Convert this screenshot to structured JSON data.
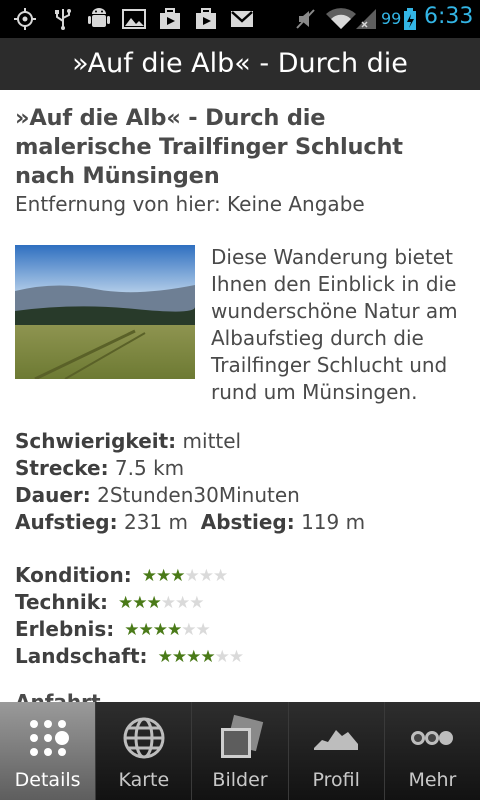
{
  "status_bar": {
    "battery_percent": "99",
    "time": "6:33",
    "icons": [
      "gps-icon",
      "usb-icon",
      "android-debug-icon",
      "picture-icon",
      "play-store-icon",
      "play-store-icon",
      "gmail-icon",
      "mute-icon",
      "wifi-icon",
      "signal-icon",
      "battery-icon"
    ],
    "accent_color": "#33b5e5"
  },
  "action_bar": {
    "title": "»Auf die Alb« - Durch die"
  },
  "article": {
    "title": "»Auf die Alb« - Durch die malerische Trailfinger Schlucht nach Münsingen",
    "distance": "Entfernung von hier: Keine Angabe",
    "description": "Diese Wanderung bietet Ihnen den Einblick in die wunderschöne Natur am Albaufstieg durch die Trailfinger Schlucht und rund um Münsingen.",
    "facts": {
      "difficulty_label": "Schwierigkeit:",
      "difficulty_value": " mittel",
      "distance_label": "Strecke:",
      "distance_value": " 7.5 km",
      "duration_label": "Dauer:",
      "duration_value": " 2Stunden30Minuten",
      "ascent_label": "Aufstieg:",
      "ascent_value": " 231 m",
      "descent_label": "Abstieg:",
      "descent_value": " 119 m"
    },
    "ratings": [
      {
        "label": "Kondition:",
        "stars": 3,
        "max": 6
      },
      {
        "label": "Technik:",
        "stars": 3,
        "max": 6
      },
      {
        "label": "Erlebnis:",
        "stars": 4,
        "max": 6
      },
      {
        "label": "Landschaft:",
        "stars": 4,
        "max": 6
      }
    ],
    "cut_off_heading": "Anfahrt"
  },
  "tabs": [
    {
      "label": "Details",
      "icon": "dots-grid-icon",
      "active": true
    },
    {
      "label": "Karte",
      "icon": "globe-icon",
      "active": false
    },
    {
      "label": "Bilder",
      "icon": "photos-icon",
      "active": false
    },
    {
      "label": "Profil",
      "icon": "elevation-profile-icon",
      "active": false
    },
    {
      "label": "Mehr",
      "icon": "more-icon",
      "active": false
    }
  ],
  "colors": {
    "star_on": "#4a7a18",
    "star_off": "#dadada",
    "title_bar": "#2c2c2c"
  }
}
